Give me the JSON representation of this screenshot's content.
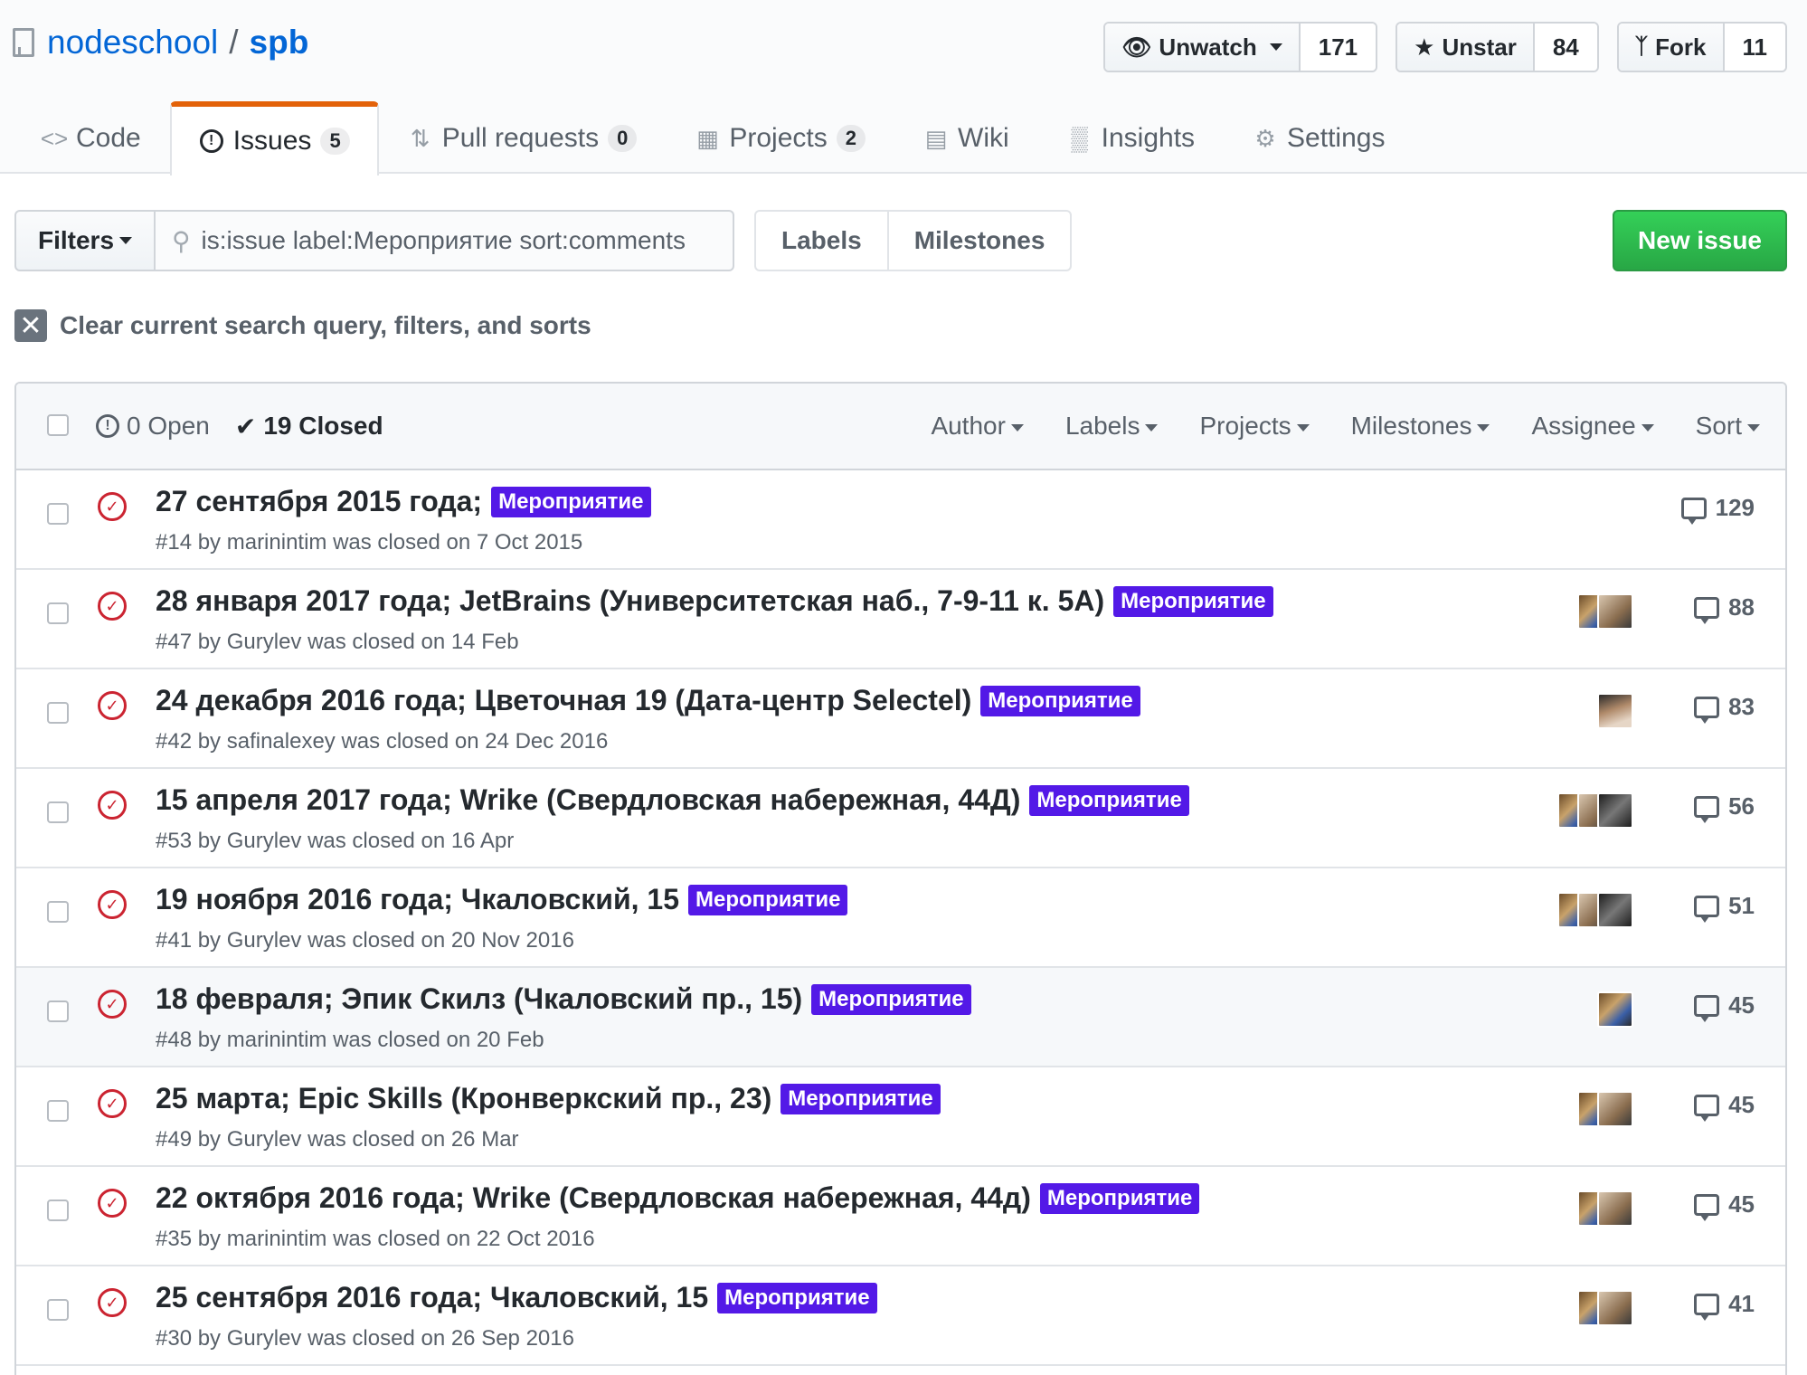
{
  "repo": {
    "owner": "nodeschool",
    "separator": "/",
    "name": "spb"
  },
  "actions": {
    "watch": {
      "label": "Unwatch",
      "count": "171",
      "icon": "eye-icon"
    },
    "star": {
      "label": "Unstar",
      "count": "84",
      "icon": "star-icon"
    },
    "fork": {
      "label": "Fork",
      "count": "11",
      "icon": "fork-icon"
    }
  },
  "tabs": [
    {
      "label": "Code",
      "counter": "",
      "icon": "code-icon"
    },
    {
      "label": "Issues",
      "counter": "5",
      "icon": "issue-icon",
      "selected": true
    },
    {
      "label": "Pull requests",
      "counter": "0",
      "icon": "pull-request-icon"
    },
    {
      "label": "Projects",
      "counter": "2",
      "icon": "project-icon"
    },
    {
      "label": "Wiki",
      "counter": "",
      "icon": "book-icon"
    },
    {
      "label": "Insights",
      "counter": "",
      "icon": "graph-icon"
    },
    {
      "label": "Settings",
      "counter": "",
      "icon": "gear-icon"
    }
  ],
  "subnav": {
    "filters_label": "Filters",
    "search_value": "is:issue label:Мероприятие sort:comments",
    "labels_label": "Labels",
    "milestones_label": "Milestones",
    "new_issue_label": "New issue"
  },
  "clear_query_label": "Clear current search query, filters, and sorts",
  "list_header": {
    "open_label": "0 Open",
    "closed_label": "19 Closed",
    "filters": [
      "Author",
      "Labels",
      "Projects",
      "Milestones",
      "Assignee",
      "Sort"
    ]
  },
  "label_color": "#5319e7",
  "issues": [
    {
      "title": "27 сентября 2015 года;",
      "label": "Мероприятие",
      "meta": "#14 by marinintim was closed on 7 Oct 2015",
      "comments": "129"
    },
    {
      "title": "28 января 2017 года; JetBrains (Университетская наб., 7-9-11 к. 5А)",
      "label": "Мероприятие",
      "meta": "#47 by Gurylev was closed on 14 Feb",
      "comments": "88"
    },
    {
      "title": "24 декабря 2016 года; Цветочная 19 (Дата-центр Selectel)",
      "label": "Мероприятие",
      "meta": "#42 by safinalexey was closed on 24 Dec 2016",
      "comments": "83"
    },
    {
      "title": "15 апреля 2017 года; Wrike (Свердловская набережная, 44Д)",
      "label": "Мероприятие",
      "meta": "#53 by Gurylev was closed on 16 Apr",
      "comments": "56"
    },
    {
      "title": "19 ноября 2016 года; Чкаловский, 15",
      "label": "Мероприятие",
      "meta": "#41 by Gurylev was closed on 20 Nov 2016",
      "comments": "51"
    },
    {
      "title": "18 февраля; Эпик Скилз (Чкаловский пр., 15)",
      "label": "Мероприятие",
      "meta": "#48 by marinintim was closed on 20 Feb",
      "comments": "45"
    },
    {
      "title": "25 марта; Epic Skills (Кронверкский пр., 23)",
      "label": "Мероприятие",
      "meta": "#49 by Gurylev was closed on 26 Mar",
      "comments": "45"
    },
    {
      "title": "22 октября 2016 года; Wrike (Свердловская набережная, 44д)",
      "label": "Мероприятие",
      "meta": "#35 by marinintim was closed on 22 Oct 2016",
      "comments": "45"
    },
    {
      "title": "25 сентября 2016 года; Чкаловский, 15",
      "label": "Мероприятие",
      "meta": "#30 by Gurylev was closed on 26 Sep 2016",
      "comments": "41"
    }
  ]
}
